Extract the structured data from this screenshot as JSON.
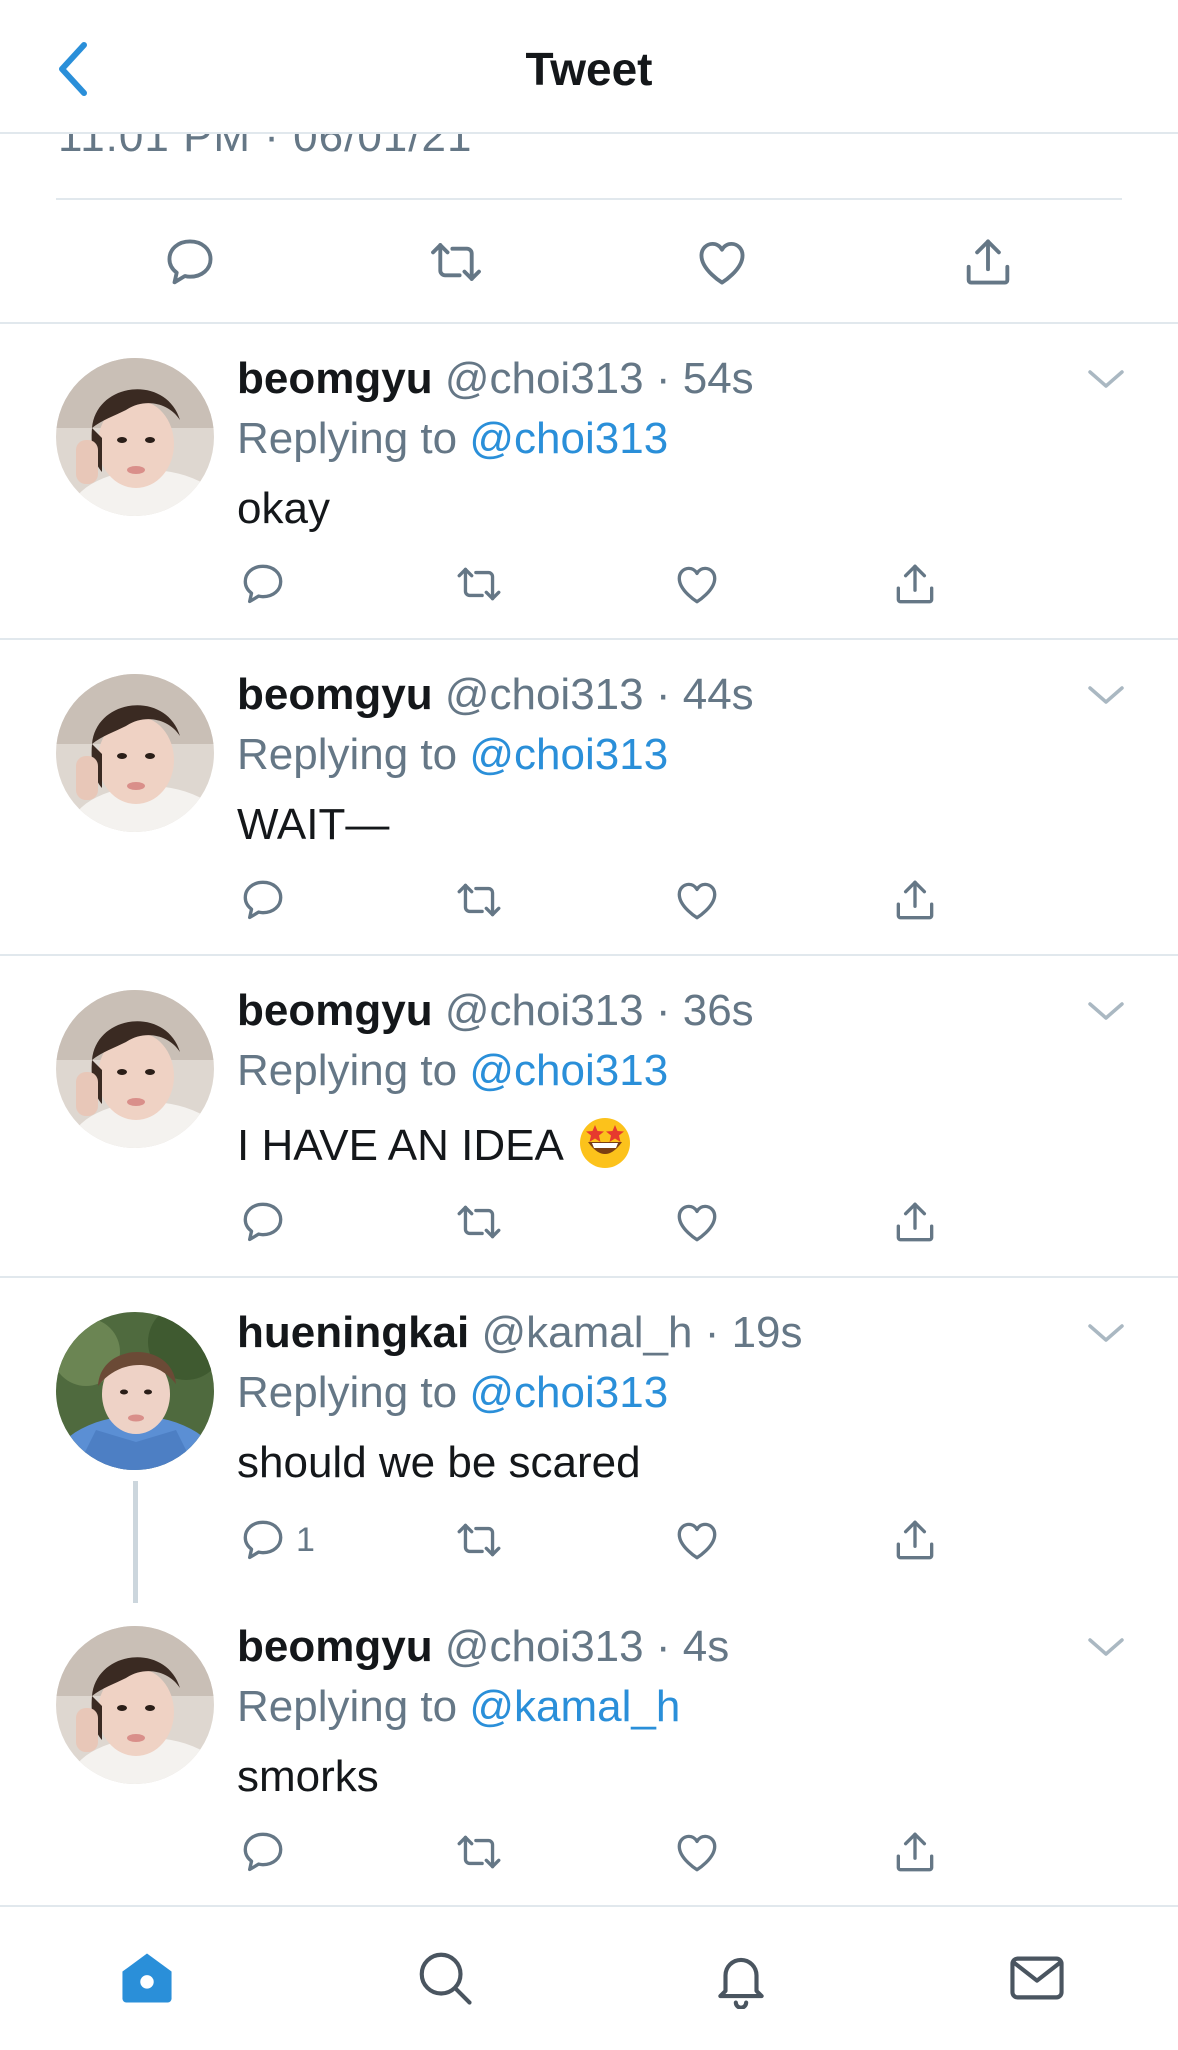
{
  "header": {
    "title": "Tweet",
    "back_icon": "chevron-left-icon"
  },
  "main_tweet": {
    "timestamp": "11:01 PM · 06/01/21",
    "actions": [
      "reply-icon",
      "retweet-icon",
      "like-icon",
      "share-icon"
    ]
  },
  "colors": {
    "accent": "#2a8fd9",
    "muted": "#657786",
    "divider": "#e1e8ed",
    "thread_line": "#ccd6dd"
  },
  "replies": [
    {
      "name": "beomgyu",
      "handle": "@choi313",
      "time": "· 54s",
      "replying_prefix": "Replying to",
      "replying_to": "@choi313",
      "text": "okay",
      "reply_count": ""
    },
    {
      "name": "beomgyu",
      "handle": "@choi313",
      "time": "· 44s",
      "replying_prefix": "Replying to",
      "replying_to": "@choi313",
      "text": "WAIT—",
      "reply_count": ""
    },
    {
      "name": "beomgyu",
      "handle": "@choi313",
      "time": "· 36s",
      "replying_prefix": "Replying to",
      "replying_to": "@choi313",
      "text": "I HAVE AN IDEA",
      "emoji": "star-struck-emoji",
      "reply_count": ""
    },
    {
      "name": "hueningkai",
      "handle": "@kamal_h",
      "time": "· 19s",
      "replying_prefix": "Replying to",
      "replying_to": "@choi313",
      "text": "should we be scared",
      "reply_count": "1"
    },
    {
      "name": "beomgyu",
      "handle": "@choi313",
      "time": "· 4s",
      "replying_prefix": "Replying to",
      "replying_to": "@kamal_h",
      "text": "smorks",
      "reply_count": ""
    }
  ],
  "tabbar": {
    "items": [
      "home-icon",
      "search-icon",
      "notifications-icon",
      "messages-icon"
    ],
    "active": "home-icon"
  }
}
